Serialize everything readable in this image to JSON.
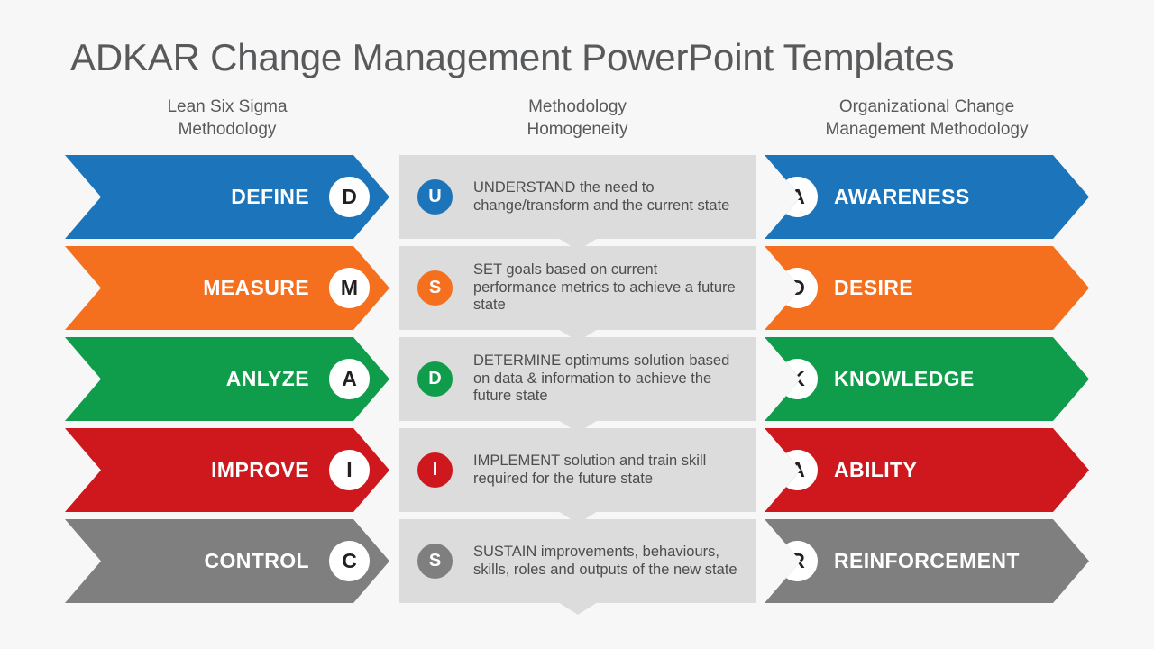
{
  "page": {
    "title": "ADKAR Change Management PowerPoint Templates",
    "background_color": "#f7f7f7",
    "title_color": "#58595b"
  },
  "palette": {
    "blue": "#1c75bb",
    "orange": "#f4701f",
    "green": "#0f9d4b",
    "red": "#ce181e",
    "gray": "#7f7f7f",
    "block_gray": "#dcdcdc",
    "badge_white": "#ffffff",
    "badge_text": "#231f20",
    "body_text": "#4d4d4f"
  },
  "columns": {
    "left": {
      "header_line1": "Lean Six Sigma",
      "header_line2": "Methodology",
      "items": [
        {
          "badge": "D",
          "label": "DEFINE",
          "color": "#1c75bb"
        },
        {
          "badge": "M",
          "label": "MEASURE",
          "color": "#f4701f"
        },
        {
          "badge": "A",
          "label": "ANLYZE",
          "color": "#0f9d4b"
        },
        {
          "badge": "I",
          "label": "IMPROVE",
          "color": "#ce181e"
        },
        {
          "badge": "C",
          "label": "CONTROL",
          "color": "#7f7f7f"
        }
      ]
    },
    "middle": {
      "header_line1": "Methodology",
      "header_line2": "Homogeneity",
      "items": [
        {
          "badge": "U",
          "color": "#1c75bb",
          "text": "UNDERSTAND the need to change/transform and the current state"
        },
        {
          "badge": "S",
          "color": "#f4701f",
          "text": "SET goals based on current performance metrics to achieve a future state"
        },
        {
          "badge": "D",
          "color": "#0f9d4b",
          "text": "DETERMINE optimums solution based on data & information to achieve the future state"
        },
        {
          "badge": "I",
          "color": "#ce181e",
          "text": "IMPLEMENT solution and train skill required for the future state"
        },
        {
          "badge": "S",
          "color": "#7f7f7f",
          "text": "SUSTAIN improvements, behaviours, skills, roles and outputs of the new state"
        }
      ]
    },
    "right": {
      "header_line1": "Organizational  Change",
      "header_line2": "Management  Methodology",
      "items": [
        {
          "badge": "A",
          "label": "AWARENESS",
          "color": "#1c75bb"
        },
        {
          "badge": "D",
          "label": "DESIRE",
          "color": "#f4701f"
        },
        {
          "badge": "K",
          "label": "KNOWLEDGE",
          "color": "#0f9d4b"
        },
        {
          "badge": "A",
          "label": "ABILITY",
          "color": "#ce181e"
        },
        {
          "badge": "R",
          "label": "REINFORCEMENT",
          "color": "#7f7f7f"
        }
      ]
    }
  }
}
